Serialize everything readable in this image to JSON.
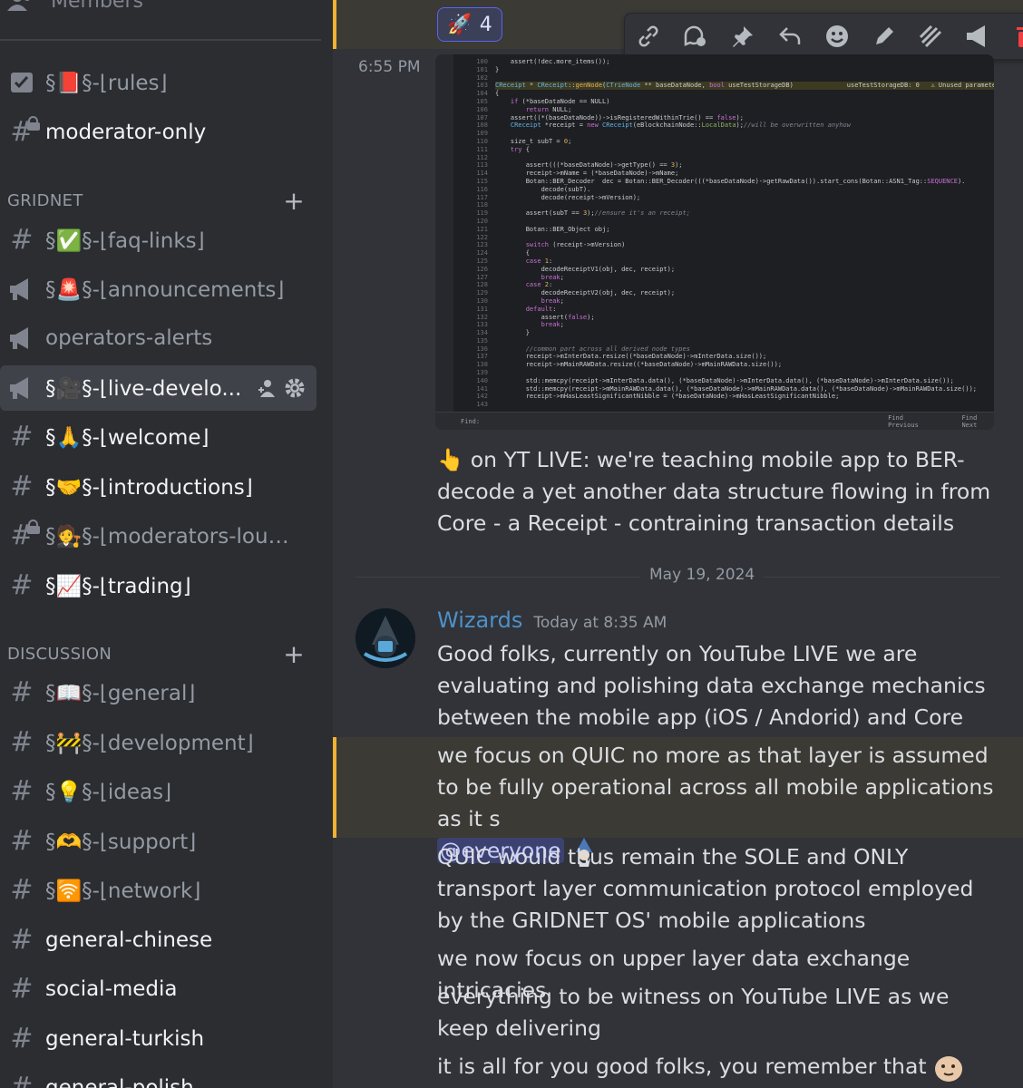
{
  "sidebar": {
    "top_item": {
      "icon": "members-icon",
      "label": "Members"
    },
    "channels_top": [
      {
        "icon": "rules-icon",
        "label": "§📕§-⌊rules⌋"
      },
      {
        "icon": "locked-hash-icon",
        "label": "moderator-only"
      }
    ],
    "category_gridnet": {
      "label": "GRIDNET",
      "add": "+"
    },
    "gridnet_channels": [
      {
        "icon": "hash-icon",
        "label": "§✅§-⌊faq-links⌋"
      },
      {
        "icon": "megaphone-icon",
        "label": "§🚨§-⌊announcements⌋"
      },
      {
        "icon": "megaphone-icon",
        "label": "operators-alerts"
      },
      {
        "icon": "megaphone-icon",
        "label": "§🎥§-⌊live-develo..."
      },
      {
        "icon": "hash-icon",
        "label": "§🙏§-⌊welcome⌋"
      },
      {
        "icon": "hash-icon",
        "label": "§🤝§-⌊introductions⌋"
      },
      {
        "icon": "locked-hash-icon",
        "label": "§🧑‍⚖️§-⌊moderators-loun..."
      },
      {
        "icon": "hash-icon",
        "label": "§📈§-⌊trading⌋"
      }
    ],
    "category_discussion": {
      "label": "DISCUSSION",
      "add": "+"
    },
    "discussion_channels": [
      {
        "icon": "hash-icon",
        "label": "§📖§-⌊general⌋"
      },
      {
        "icon": "hash-icon",
        "label": "§🚧§-⌊development⌋"
      },
      {
        "icon": "hash-icon",
        "label": "§💡§-⌊ideas⌋"
      },
      {
        "icon": "hash-icon",
        "label": "§🫶§-⌊support⌋"
      },
      {
        "icon": "hash-icon",
        "label": "§🛜§-⌊network⌋"
      },
      {
        "icon": "hash-icon",
        "label": "general-chinese"
      },
      {
        "icon": "hash-icon",
        "label": "social-media"
      },
      {
        "icon": "hash-icon",
        "label": "general-turkish"
      },
      {
        "icon": "hash-icon",
        "label": "general-polish"
      }
    ]
  },
  "chat": {
    "reaction": {
      "emoji": "🚀",
      "count": "4"
    },
    "toolbar": [
      "link-icon",
      "thread-icon",
      "pin-icon",
      "reply-icon",
      "emoji-icon",
      "edit-icon",
      "forward-icon",
      "announce-icon",
      "delete-icon"
    ],
    "msg1": {
      "time": "6:55 PM",
      "text": "👆 on YT LIVE: we're teaching mobile app to BER-decode a yet another data structure flowing in from Core - a Receipt - contraining transaction details"
    },
    "date_separator": "May 19, 2024",
    "msg2": {
      "author": "Wizards",
      "timestamp": "Today at 8:35 AM",
      "lines": [
        "Good folks, currently on YouTube LIVE we are evaluating and polishing data exchange mechanics between the mobile app (iOS / Andorid) and Core nodes",
        "we focus on QUIC no more as that layer is assumed to be fully operational across all mobile applications as it s",
        "QUIC would thus remain the SOLE and ONLY transport layer communication protocol employed by the GRIDNET OS' mobile applications",
        "we now focus on upper layer data exchange intricacies",
        "everything to be witness on YouTube LIVE as we keep delivering",
        "it is all for you good folks, you remember that"
      ],
      "mention": "@everyone"
    },
    "colors": {
      "accent": "#5865f2",
      "highlight_bar": "#f0b232",
      "author": "#4e90c8"
    }
  }
}
